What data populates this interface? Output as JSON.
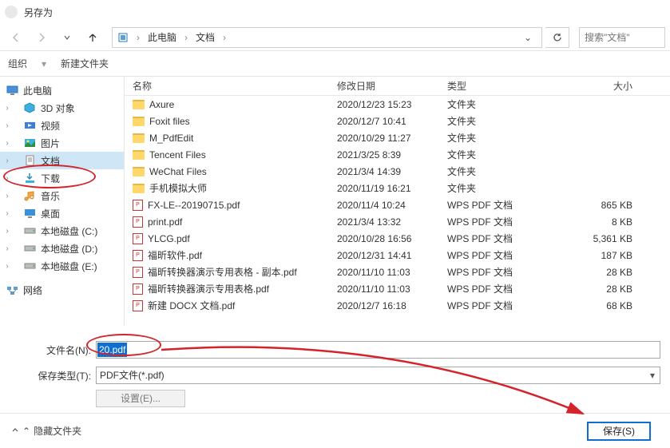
{
  "title": "另存为",
  "breadcrumb": {
    "root": "此电脑",
    "folder": "文档"
  },
  "search_placeholder": "搜索\"文档\"",
  "toolbar": {
    "organize": "组织",
    "newfolder": "新建文件夹"
  },
  "sidebar": {
    "root": "此电脑",
    "items": [
      {
        "label": "3D 对象",
        "icon": "3d"
      },
      {
        "label": "视频",
        "icon": "video"
      },
      {
        "label": "图片",
        "icon": "pictures"
      },
      {
        "label": "文档",
        "icon": "documents",
        "selected": true
      },
      {
        "label": "下载",
        "icon": "downloads"
      },
      {
        "label": "音乐",
        "icon": "music"
      },
      {
        "label": "桌面",
        "icon": "desktop"
      },
      {
        "label": "本地磁盘 (C:)",
        "icon": "drive"
      },
      {
        "label": "本地磁盘 (D:)",
        "icon": "drive"
      },
      {
        "label": "本地磁盘 (E:)",
        "icon": "drive"
      }
    ],
    "network": "网络"
  },
  "columns": {
    "name": "名称",
    "date": "修改日期",
    "type": "类型",
    "size": "大小"
  },
  "files": [
    {
      "name": "Axure",
      "date": "2020/12/23 15:23",
      "type": "文件夹",
      "size": "",
      "kind": "folder"
    },
    {
      "name": "Foxit files",
      "date": "2020/12/7 10:41",
      "type": "文件夹",
      "size": "",
      "kind": "folder"
    },
    {
      "name": "M_PdfEdit",
      "date": "2020/10/29 11:27",
      "type": "文件夹",
      "size": "",
      "kind": "folder"
    },
    {
      "name": "Tencent Files",
      "date": "2021/3/25 8:39",
      "type": "文件夹",
      "size": "",
      "kind": "folder"
    },
    {
      "name": "WeChat Files",
      "date": "2021/3/4 14:39",
      "type": "文件夹",
      "size": "",
      "kind": "folder"
    },
    {
      "name": "手机模拟大师",
      "date": "2020/11/19 16:21",
      "type": "文件夹",
      "size": "",
      "kind": "folder"
    },
    {
      "name": "FX-LE--20190715.pdf",
      "date": "2020/11/4 10:24",
      "type": "WPS PDF 文档",
      "size": "865 KB",
      "kind": "pdf"
    },
    {
      "name": "print.pdf",
      "date": "2021/3/4 13:32",
      "type": "WPS PDF 文档",
      "size": "8 KB",
      "kind": "pdf"
    },
    {
      "name": "YLCG.pdf",
      "date": "2020/10/28 16:56",
      "type": "WPS PDF 文档",
      "size": "5,361 KB",
      "kind": "pdf"
    },
    {
      "name": "福昕软件.pdf",
      "date": "2020/12/31 14:41",
      "type": "WPS PDF 文档",
      "size": "187 KB",
      "kind": "pdf"
    },
    {
      "name": "福昕转换器演示专用表格 - 副本.pdf",
      "date": "2020/11/10 11:03",
      "type": "WPS PDF 文档",
      "size": "28 KB",
      "kind": "pdf"
    },
    {
      "name": "福昕转换器演示专用表格.pdf",
      "date": "2020/11/10 11:03",
      "type": "WPS PDF 文档",
      "size": "28 KB",
      "kind": "pdf"
    },
    {
      "name": "新建 DOCX 文档.pdf",
      "date": "2020/12/7 16:18",
      "type": "WPS PDF 文档",
      "size": "68 KB",
      "kind": "pdf"
    }
  ],
  "fields": {
    "filename_label": "文件名(N):",
    "filename_value": "20.pdf",
    "filetype_label": "保存类型(T):",
    "filetype_value": "PDF文件(*.pdf)",
    "settings_label": "设置(E)..."
  },
  "footer": {
    "hide_folders": "隐藏文件夹",
    "save": "保存(S)"
  },
  "annotations": {
    "ellipse_sidebar": "highlight on 文档 sidebar item",
    "ellipse_filename": "highlight on filename input",
    "arrow": "red arrow from filename to save button"
  }
}
